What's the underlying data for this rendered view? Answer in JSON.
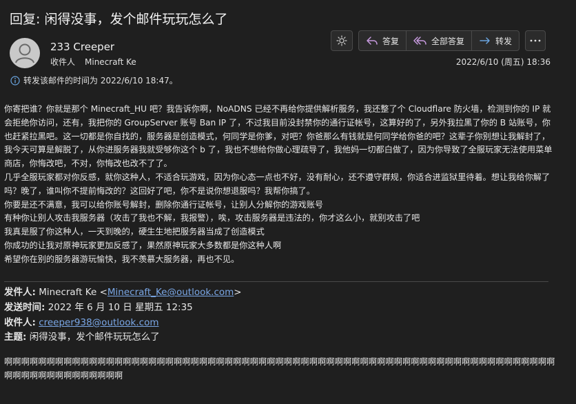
{
  "email": {
    "subject": "回复: 闲得没事，发个邮件玩玩怎么了",
    "sender_name": "233 Creeper",
    "recipient_label": "收件人",
    "recipient_name": "Minecraft Ke",
    "datetime": "2022/6/10 (周五) 18:36",
    "forward_info": "转发该邮件的时间为 2022/6/10 18:47。"
  },
  "toolbar": {
    "reply_label": "答复",
    "reply_all_label": "全部答复",
    "forward_label": "转发"
  },
  "body_paragraphs": [
    "你寄把谁？你就是那个 Minecraft_HU 吧？我告诉你啊，NoADNS 已经不再给你提供解析服务，我还整了个 Cloudflare 防火墙，检测到你的 IP 就会拒绝你访问，还有，我把你的 GroupServer 账号 Ban IP 了，不过我目前没封禁你的通行证帐号，这算好的了，另外我拉黑了你的 B 站账号，你也赶紧拉黑吧。这一切都是你自找的，服务器是创造模式，何同学是你爹，对吧？你爸那么有钱就是何同学给你爸的吧？这辈子你别想让我解封了，我今天可算是解脱了，从你进服务器我就受够你这个 b 了，我也不想给你做心理疏导了，我他妈一切都白做了，因为你导致了全服玩家无法使用菜单商店，你悔改吧，不对，你悔改也改不了了。",
    "几乎全服玩家都对你反感，就你这种人，不适合玩游戏，因为你心态一点也不好，没有耐心，还不遵守群规，你适合进监狱里待着。想让我给你解了吗？晚了，谁叫你不提前悔改的？这回好了吧，你不是说你想退服吗？我帮你搞了。",
    "你要是还不满意，我可以给你账号解封，删除你通行证帐号，让别人分解你的游戏账号",
    "有种你让别人攻击我服务器（攻击了我也不解，我报警），唉，攻击服务器是违法的，你才这么小，就别攻击了吧",
    "我真是服了你这种人，一天到晚的，硬生生地把服务器当成了创造模式",
    "你成功的让我对原神玩家更加反感了，果然原神玩家大多数都是你这种人啊",
    "希望你在别的服务器游玩愉快，我不羡慕大服务器，再也不见。"
  ],
  "quoted_header": {
    "from_label": "发件人:",
    "from_name": "Minecraft Ke <",
    "from_email": "Minecraft_Ke@outlook.com",
    "from_close": ">",
    "sent_label": "发送时间:",
    "sent_value": "2022 年 6 月 10 日 星期五 12:35",
    "to_label": "收件人:",
    "to_email": "creeper938@outlook.com",
    "subject_label": "主题:",
    "subject_value": "闲得没事，发个邮件玩玩怎么了"
  },
  "quoted_body": "啊啊啊啊啊啊啊啊啊啊啊啊啊啊啊啊啊啊啊啊啊啊啊啊啊啊啊啊啊啊啊啊啊啊啊啊啊啊啊啊啊啊啊啊啊啊啊啊啊啊啊啊啊啊啊啊啊啊啊啊啊啊啊啊啊啊啊啊啊啊啊啊啊啊啊啊啊啊啊",
  "colors": {
    "background": "#1f1f1f",
    "accent": "#c79adf",
    "forward_accent": "#6aa5e0",
    "link": "#7aa7e6"
  }
}
